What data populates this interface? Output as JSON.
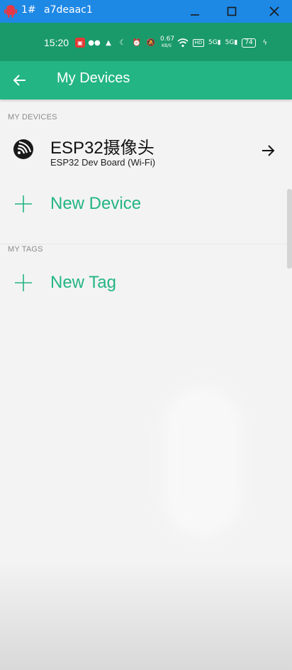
{
  "window": {
    "index": "1#",
    "title": "a7deaac1"
  },
  "status_bar": {
    "time": "15:20",
    "net_speed": "0.67",
    "net_unit": "KB/S",
    "signal_1": "5G",
    "signal_2": "5G",
    "battery": "74",
    "icons": [
      "app-notification-icon",
      "wechat-icon",
      "app-icon",
      "do-not-disturb-icon",
      "alarm-icon",
      "mute-icon",
      "wifi-icon",
      "hd-icon",
      "signal-icon",
      "signal-icon",
      "battery-icon",
      "charging-icon"
    ]
  },
  "app_bar": {
    "title": "My Devices"
  },
  "sections": {
    "devices_label": "MY DEVICES",
    "tags_label": "MY TAGS"
  },
  "device": {
    "name": "ESP32摄像头",
    "board": "ESP32 Dev Board (Wi-Fi)",
    "icon": "espressif-icon"
  },
  "actions": {
    "new_device": "New Device",
    "new_tag": "New Tag"
  },
  "colors": {
    "window_bar": "#1e88e5",
    "status_bar": "#1a9a6a",
    "app_bar": "#23b583",
    "accent": "#23b583"
  }
}
